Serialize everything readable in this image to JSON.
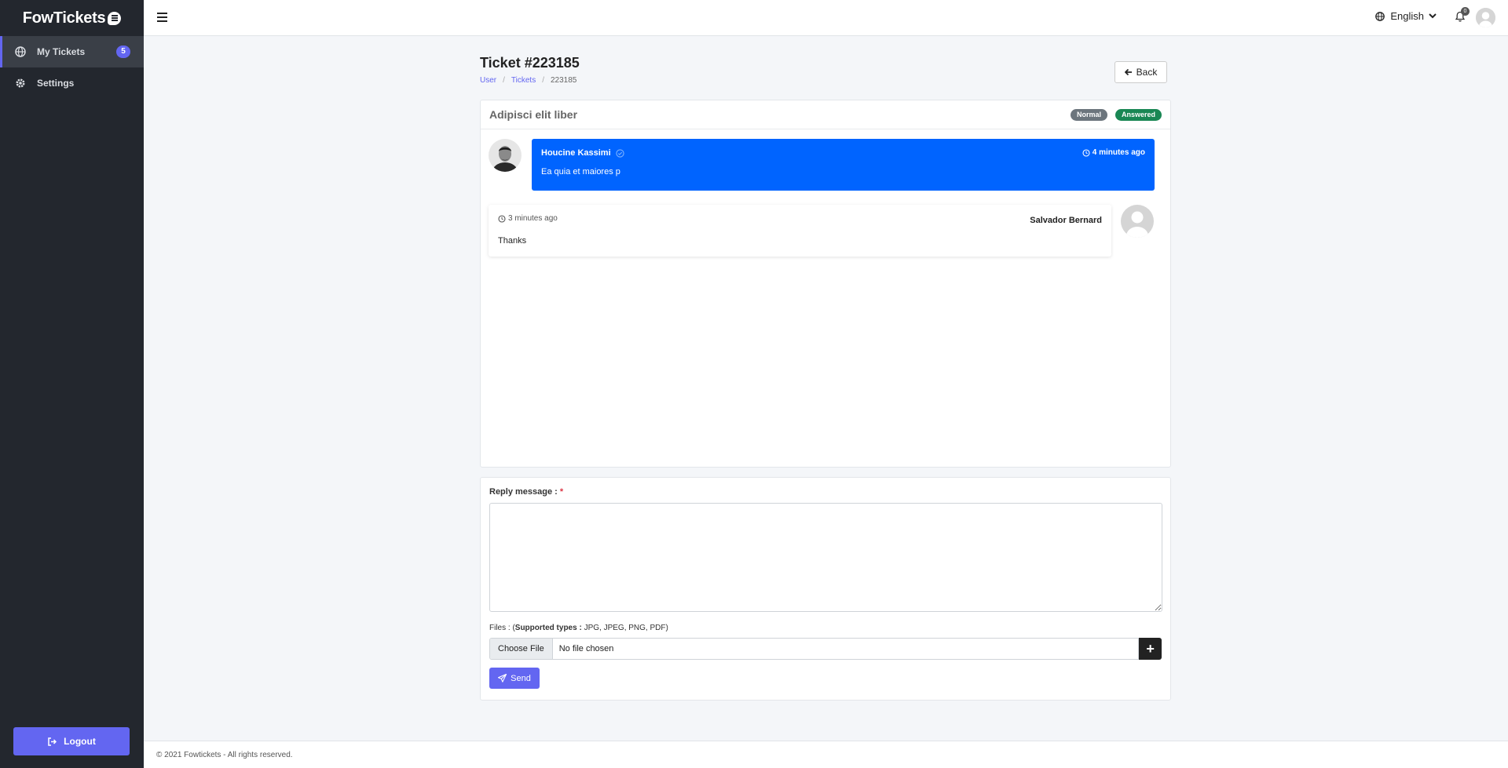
{
  "brand": {
    "name": "FowTickets"
  },
  "sidebar": {
    "items": [
      {
        "label": "My Tickets",
        "badge": "5",
        "icon": "globe-ticket-icon"
      },
      {
        "label": "Settings",
        "icon": "gear-icon"
      }
    ],
    "logout_label": "Logout"
  },
  "topbar": {
    "language": "English",
    "notifications_count": "0"
  },
  "page": {
    "title": "Ticket #223185",
    "breadcrumb": [
      "User",
      "Tickets",
      "223185"
    ],
    "back_label": "Back"
  },
  "ticket": {
    "subject": "Adipisci elit liber",
    "priority": "Normal",
    "status": "Answered",
    "messages": [
      {
        "author": "Houcine Kassimi",
        "time": "4 minutes ago",
        "body": "Ea quia et maiores p"
      },
      {
        "author": "Salvador Bernard",
        "time": "3 minutes ago",
        "body": "Thanks"
      }
    ]
  },
  "reply": {
    "label": "Reply message :",
    "required_mark": "*",
    "files_label": "Files : (",
    "supported_label": "Supported types :",
    "supported_types": " JPG, JPEG, PNG, PDF)",
    "choose_file": "Choose File",
    "no_file": "No file chosen",
    "add_symbol": "+",
    "send_label": "Send"
  },
  "footer": {
    "text": "© 2021 Fowtickets - All rights reserved."
  },
  "colors": {
    "accent": "#6366f1",
    "message_blue": "#0064ff",
    "answered": "#198754",
    "normal": "#6c757d",
    "sidebar": "#23272e"
  }
}
